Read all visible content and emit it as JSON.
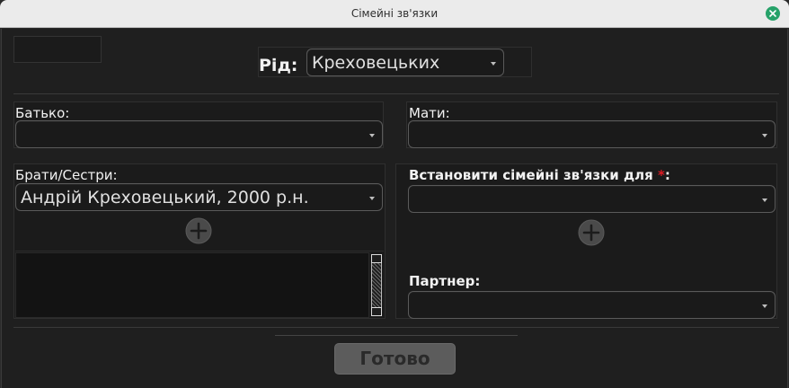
{
  "window": {
    "title": "Сімейні зв'язки"
  },
  "header": {
    "clan_label": "Рід:",
    "clan_value": "Креховецьких"
  },
  "father": {
    "label": "Батько:",
    "value": ""
  },
  "mother": {
    "label": "Мати:",
    "value": ""
  },
  "siblings": {
    "label": "Брати/Сестри:",
    "value": "Андрій Креховецький, 2000 р.н."
  },
  "relations_for": {
    "label_prefix": "Встановити сімейні зв'язки для ",
    "required_mark": "*",
    "label_suffix": ":",
    "value": ""
  },
  "partner": {
    "label": "Партнер:",
    "value": ""
  },
  "footer": {
    "done_label": "Готово"
  },
  "icons": {
    "close": "close-icon",
    "add": "plus-circle-icon",
    "dropdown": "chevron-down-icon"
  },
  "colors": {
    "close_button": "#26a269",
    "required": "#e01b24",
    "panel_bg": "#1b1b1b",
    "titlebar_bg": "#ebebeb"
  }
}
